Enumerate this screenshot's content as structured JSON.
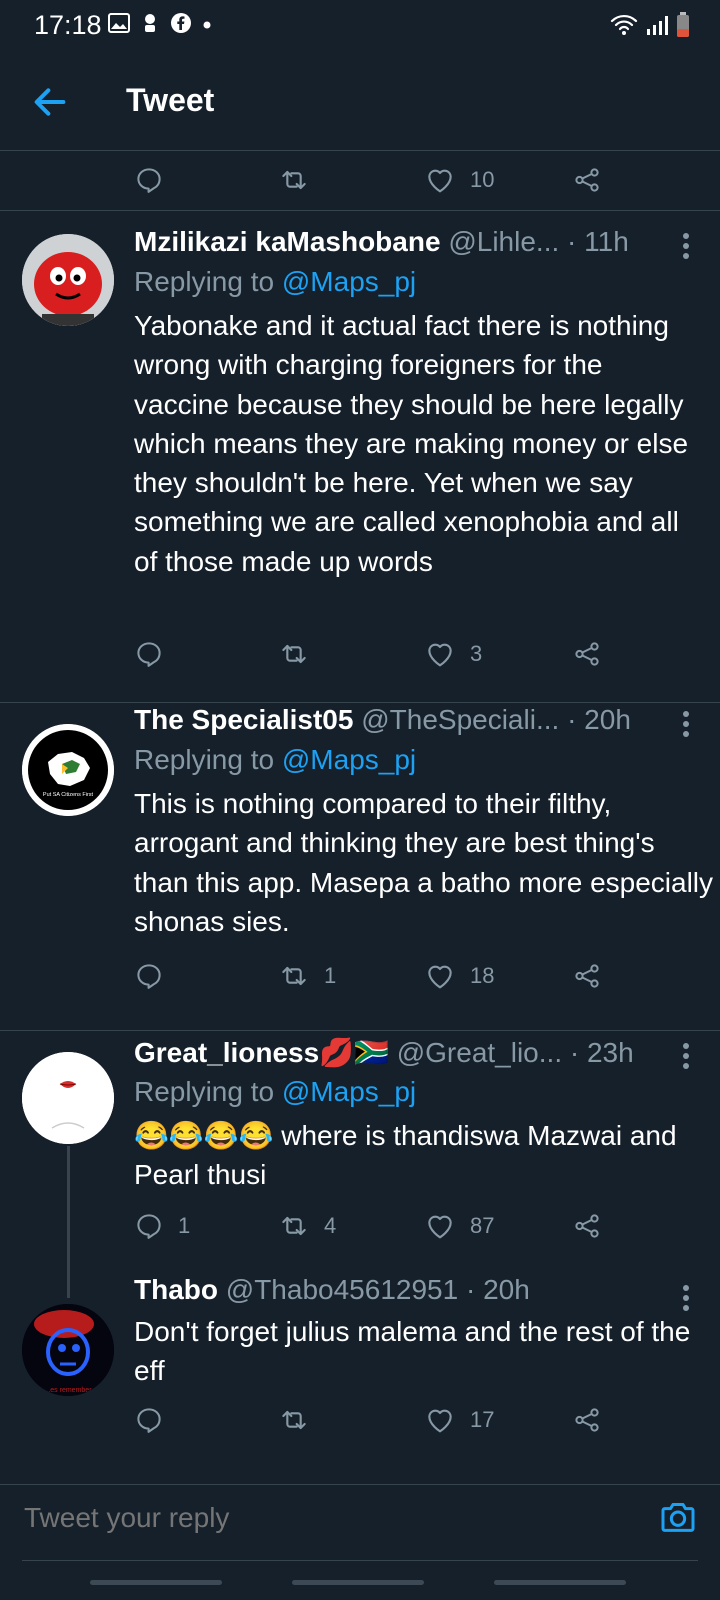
{
  "status": {
    "time": "17:18"
  },
  "header": {
    "title": "Tweet"
  },
  "top_actions": {
    "likes": "10"
  },
  "tweets": [
    {
      "name": "Mzilikazi kaMashobane",
      "handle": "@Lihle...",
      "time": "· 11h",
      "replying_prefix": "Replying to",
      "replying_to": "@Maps_pj",
      "text": "Yabonake and it actual fact there is nothing wrong with charging foreigners for the vaccine because they should be here legally which means they are making money or else they shouldn't be here. Yet when we say something we are called xenophobia and all of those made up words",
      "replies": "",
      "retweets": "",
      "likes": "3"
    },
    {
      "name": "The Specialist05",
      "handle": "@TheSpeciali...",
      "time": "· 20h",
      "replying_prefix": "Replying to",
      "replying_to": "@Maps_pj",
      "text": "This is nothing compared to their filthy, arrogant and thinking they are best thing's than this app. Masepa a batho more especially shonas sies.",
      "replies": "",
      "retweets": "1",
      "likes": "18",
      "avatar_text": "Put SA Citizens First"
    },
    {
      "name": "Great_lioness💋🇿🇦",
      "handle": "@Great_lio...",
      "time": "· 23h",
      "replying_prefix": "Replying to",
      "replying_to": "@Maps_pj",
      "text": "😂😂😂😂 where is thandiswa Mazwai and Pearl thusi",
      "replies": "1",
      "retweets": "4",
      "likes": "87"
    },
    {
      "name": "Thabo",
      "handle": "@Thabo45612951",
      "time": "· 20h",
      "text": "Don't forget julius malema and the rest of the eff",
      "replies": "",
      "retweets": "",
      "likes": "17",
      "avatar_text": "...es remember"
    }
  ],
  "composer": {
    "placeholder": "Tweet your reply"
  },
  "colors": {
    "background": "#15202b",
    "accent": "#1da1f2",
    "muted": "#8899a6",
    "divider": "#38444d"
  }
}
